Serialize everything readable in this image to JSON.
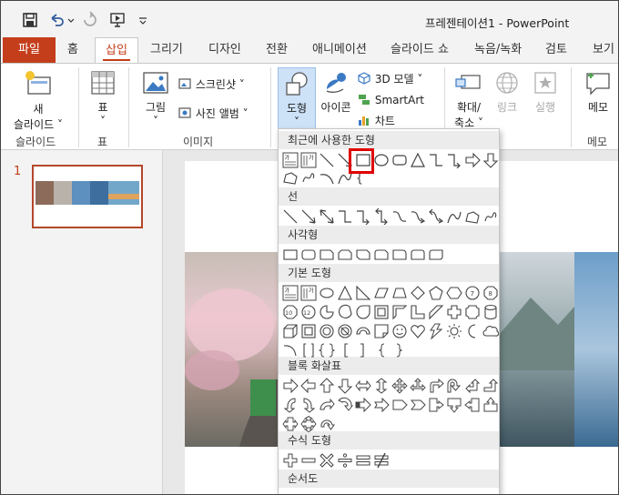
{
  "window": {
    "title": "프레젠테이션1  -  PowerPoint"
  },
  "tabs": [
    "파일",
    "홈",
    "삽입",
    "그리기",
    "디자인",
    "전환",
    "애니메이션",
    "슬라이드 쇼",
    "녹음/녹화",
    "검토",
    "보기"
  ],
  "ribbon": {
    "new_slide": [
      "새",
      "슬라이드 ˅"
    ],
    "table": [
      "표",
      "˅"
    ],
    "pictures": [
      "그림",
      "˅"
    ],
    "screenshot": "스크린샷 ˅",
    "photo_album": "사진 앨범 ˅",
    "shapes": [
      "도형",
      "˅"
    ],
    "icons": "아이콘",
    "models_3d": "3D 모델 ˅",
    "smartart": "SmartArt",
    "chart": "차트",
    "zoom": [
      "확대/",
      "축소 ˅"
    ],
    "link": "링크",
    "action": "실행",
    "comment": "메모",
    "group_labels": {
      "slides": "슬라이드",
      "tables": "표",
      "images": "이미지",
      "comments": "메모"
    }
  },
  "thumbnail": {
    "number": "1"
  },
  "shapes_menu": {
    "categories": [
      "최근에 사용한 도형",
      "선",
      "사각형",
      "기본 도형",
      "블록 화살표",
      "수식 도형",
      "순서도"
    ],
    "textbox_glyph": "가",
    "brace_text": "{ }"
  },
  "colors": {
    "accent": "#c43e1c",
    "highlight": "#e00000"
  }
}
